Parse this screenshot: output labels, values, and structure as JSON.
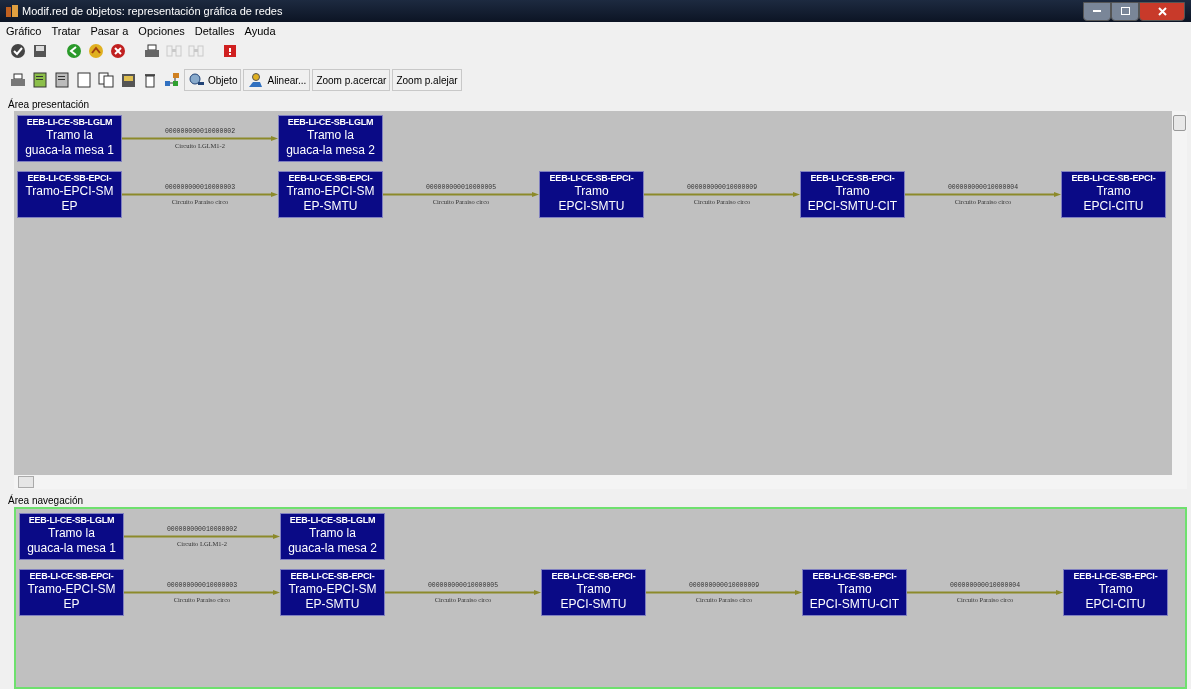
{
  "window": {
    "title": "Modif.red de objetos: representación gráfica de redes"
  },
  "menu": [
    "Gráfico",
    "Tratar",
    "Pasar a",
    "Opciones",
    "Detalles",
    "Ayuda"
  ],
  "toolbar": [
    {
      "disabled": false
    },
    {
      "disabled": false
    },
    {
      "disabled": false
    },
    {
      "disabled": false
    },
    {
      "disabled": false
    },
    {
      "disabled": false
    },
    {
      "disabled": true
    },
    {
      "disabled": true
    },
    {
      "disabled": false
    }
  ],
  "toolbar2": {
    "buttons": [
      "Objeto",
      "Alinear...",
      "Zoom p.acercar",
      "Zoom p.alejar"
    ]
  },
  "presentation_area": {
    "label": "Área presentación",
    "rows": [
      {
        "nodes": [
          {
            "code": "EEB-LI-CE-SB-LGLM",
            "lines": [
              "Tramo la",
              "guaca-la mesa 1"
            ]
          },
          {
            "code": "EEB-LI-CE-SB-LGLM",
            "lines": [
              "Tramo la",
              "guaca-la mesa 2"
            ]
          }
        ],
        "links": [
          {
            "number": "000000000010000002",
            "circuit": "Circuito LGLM1-2"
          }
        ]
      },
      {
        "nodes": [
          {
            "code": "EEB-LI-CE-SB-EPCI-",
            "lines": [
              "Tramo-EPCI-SM",
              "EP"
            ]
          },
          {
            "code": "EEB-LI-CE-SB-EPCI-",
            "lines": [
              "Tramo-EPCI-SM",
              "EP-SMTU"
            ]
          },
          {
            "code": "EEB-LI-CE-SB-EPCI-",
            "lines": [
              "Tramo",
              "EPCI-SMTU"
            ]
          },
          {
            "code": "EEB-LI-CE-SB-EPCI-",
            "lines": [
              "Tramo",
              "EPCI-SMTU-CIT"
            ]
          },
          {
            "code": "EEB-LI-CE-SB-EPCI-",
            "lines": [
              "Tramo",
              "EPCI-CITU"
            ]
          }
        ],
        "links": [
          {
            "number": "000000000010000003",
            "circuit": "Circuito Paraiso circo"
          },
          {
            "number": "000000000010000005",
            "circuit": "Circuito Paraiso circo"
          },
          {
            "number": "000000000010000009",
            "circuit": "Circuito Paraiso circo"
          },
          {
            "number": "000000000010000004",
            "circuit": "Circuito Paraiso circo"
          }
        ]
      }
    ]
  },
  "navigation_area": {
    "label": "Área navegación",
    "rows": [
      {
        "nodes": [
          {
            "code": "EEB-LI-CE-SB-LGLM",
            "lines": [
              "Tramo la",
              "guaca-la mesa 1"
            ]
          },
          {
            "code": "EEB-LI-CE-SB-LGLM",
            "lines": [
              "Tramo la",
              "guaca-la mesa 2"
            ]
          }
        ],
        "links": [
          {
            "number": "000000000010000002",
            "circuit": "Circuito LGLM1-2"
          }
        ]
      },
      {
        "nodes": [
          {
            "code": "EEB-LI-CE-SB-EPCI-",
            "lines": [
              "Tramo-EPCI-SM",
              "EP"
            ]
          },
          {
            "code": "EEB-LI-CE-SB-EPCI-",
            "lines": [
              "Tramo-EPCI-SM",
              "EP-SMTU"
            ]
          },
          {
            "code": "EEB-LI-CE-SB-EPCI-",
            "lines": [
              "Tramo",
              "EPCI-SMTU"
            ]
          },
          {
            "code": "EEB-LI-CE-SB-EPCI-",
            "lines": [
              "Tramo",
              "EPCI-SMTU-CIT"
            ]
          },
          {
            "code": "EEB-LI-CE-SB-EPCI-",
            "lines": [
              "Tramo",
              "EPCI-CITU"
            ]
          }
        ],
        "links": [
          {
            "number": "000000000010000003",
            "circuit": "Circuito Paraiso circo"
          },
          {
            "number": "000000000010000005",
            "circuit": "Circuito Paraiso circo"
          },
          {
            "number": "000000000010000009",
            "circuit": "Circuito Paraiso circo"
          },
          {
            "number": "000000000010000004",
            "circuit": "Circuito Paraiso circo"
          }
        ]
      }
    ]
  }
}
